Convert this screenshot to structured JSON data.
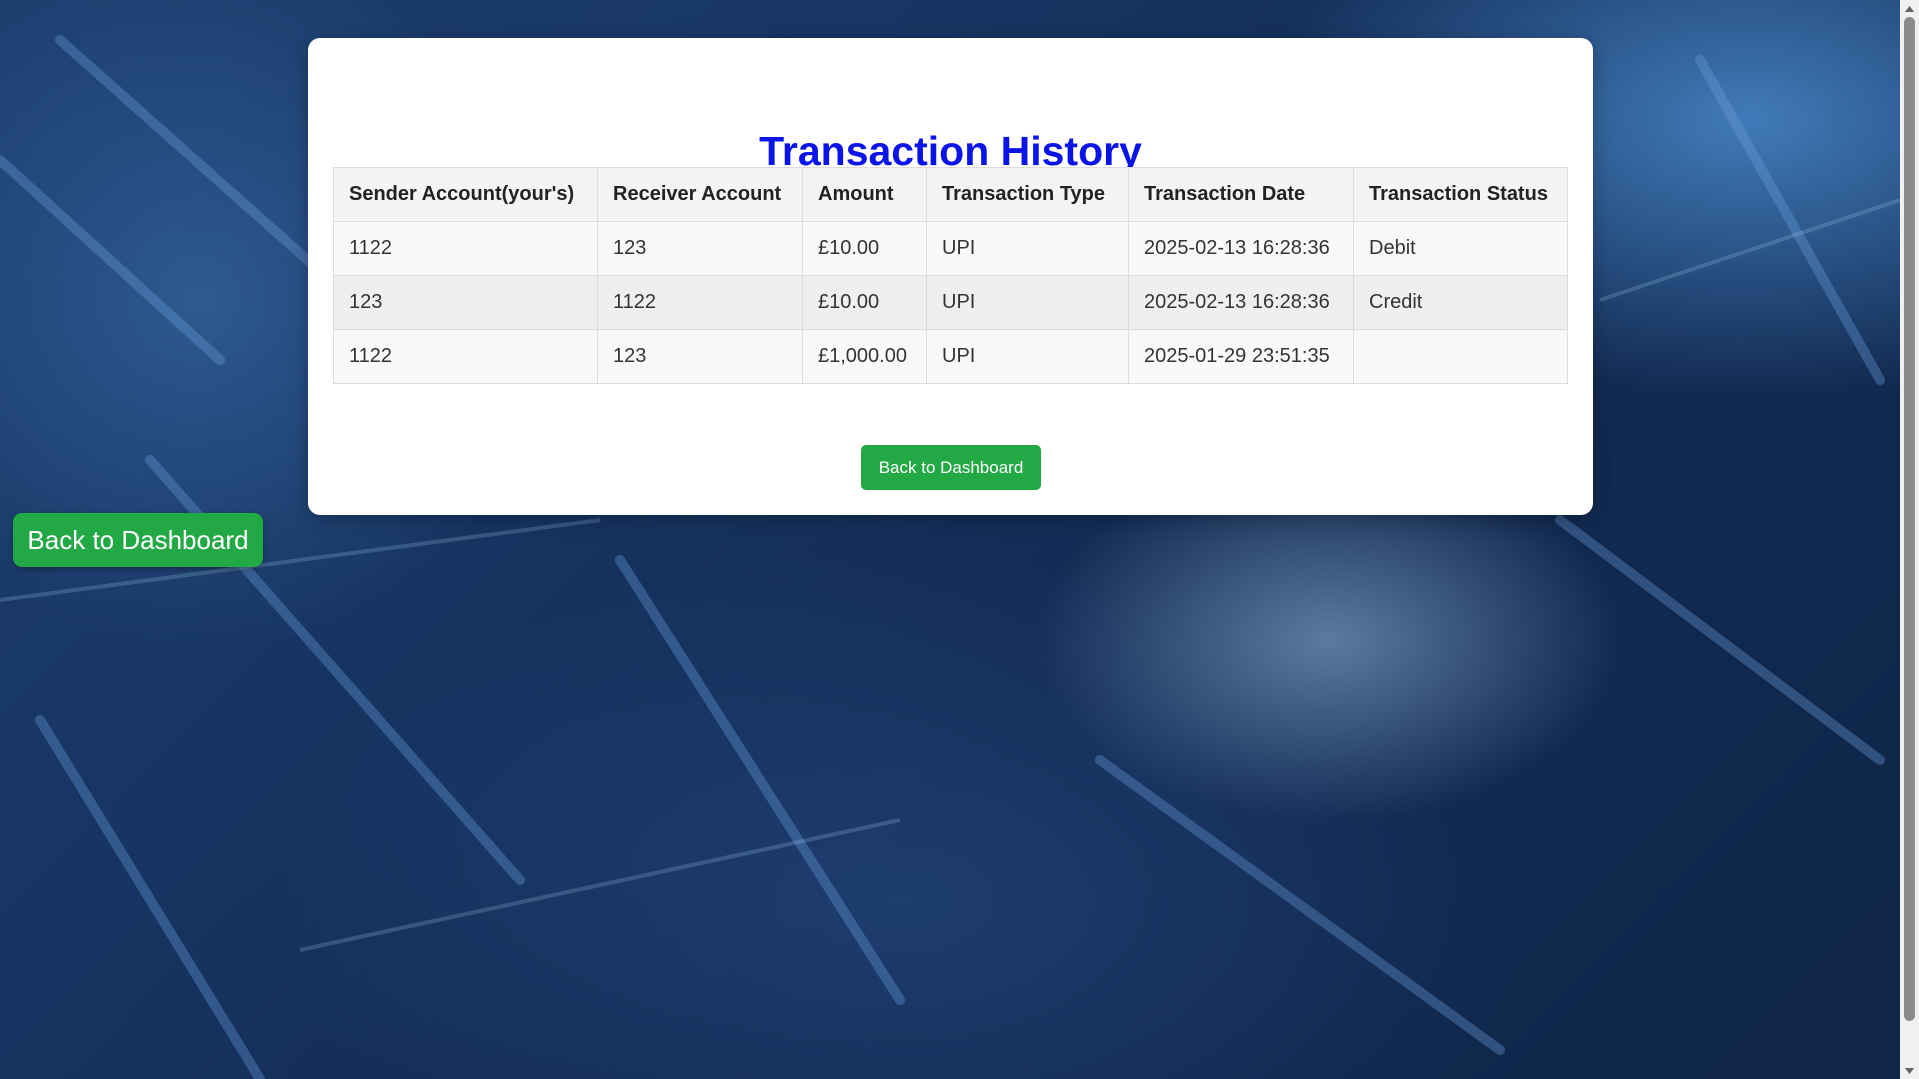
{
  "page": {
    "title": "Transaction History"
  },
  "table": {
    "headers": [
      "Sender Account(your's)",
      "Receiver Account",
      "Amount",
      "Transaction Type",
      "Transaction Date",
      "Transaction Status"
    ],
    "rows": [
      [
        "1122",
        "123",
        "£10.00",
        "UPI",
        "2025-02-13 16:28:36",
        "Debit"
      ],
      [
        "123",
        "1122",
        "£10.00",
        "UPI",
        "2025-02-13 16:28:36",
        "Credit"
      ],
      [
        "1122",
        "123",
        "£1,000.00",
        "UPI",
        "2025-01-29 23:51:35",
        ""
      ]
    ]
  },
  "buttons": {
    "card_back": "Back to Dashboard",
    "floating_back": "Back to Dashboard"
  },
  "colors": {
    "title": "#0a14e6",
    "button": "#22a845"
  },
  "icons": {
    "scroll_up": "triangle-up-icon",
    "scroll_down": "triangle-down-icon"
  }
}
